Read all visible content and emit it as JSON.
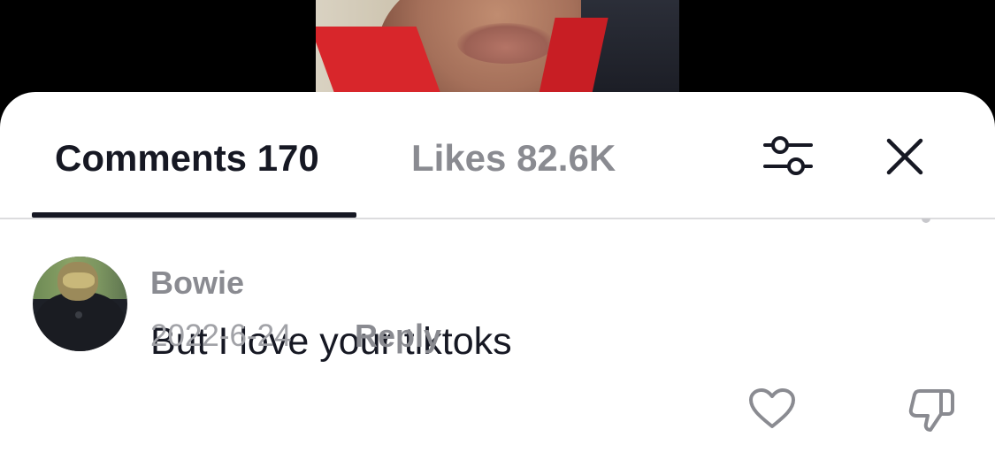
{
  "tabs": {
    "comments_label": "Comments 170",
    "likes_label": "Likes 82.6K"
  },
  "icons": {
    "filter": "sliders-icon",
    "close": "close-icon",
    "like": "heart-outline-icon",
    "dislike": "thumbs-down-icon"
  },
  "comment": {
    "username": "Bowie",
    "text": "But I love your tiktoks",
    "date": "2022-6-24",
    "reply_label": "Reply"
  },
  "colors": {
    "text_primary": "#161823",
    "text_secondary": "#8a8b91",
    "divider": "#dcdcde"
  }
}
